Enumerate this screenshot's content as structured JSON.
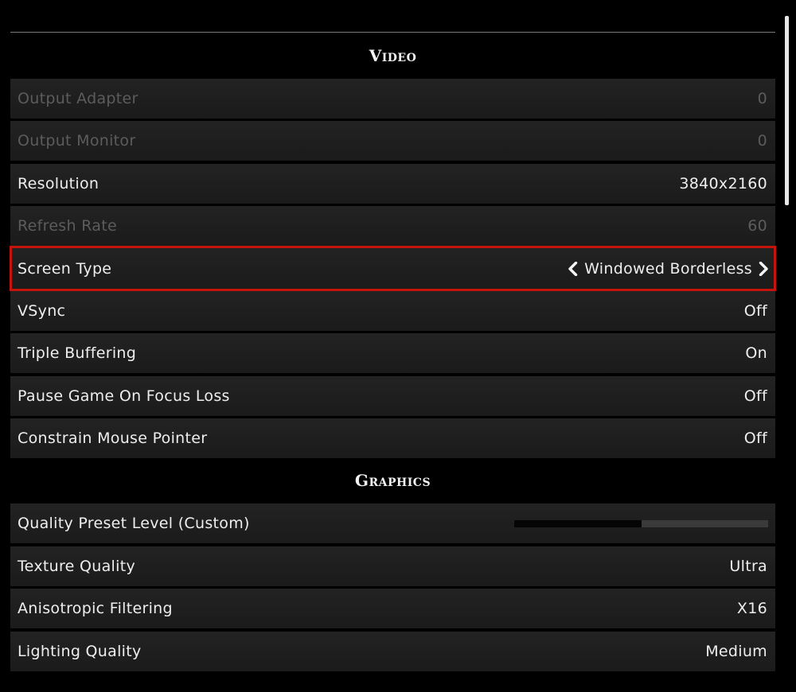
{
  "sections": {
    "video": {
      "title": "Video"
    },
    "graphics": {
      "title": "Graphics"
    }
  },
  "video_rows": [
    {
      "label": "Output Adapter",
      "value": "0",
      "enabled": false
    },
    {
      "label": "Output Monitor",
      "value": "0",
      "enabled": false
    },
    {
      "label": "Resolution",
      "value": "3840x2160",
      "enabled": true
    },
    {
      "label": "Refresh Rate",
      "value": "60",
      "enabled": false
    },
    {
      "label": "Screen Type",
      "value": "Windowed Borderless",
      "enabled": true,
      "selected": true
    },
    {
      "label": "VSync",
      "value": "Off",
      "enabled": true
    },
    {
      "label": "Triple Buffering",
      "value": "On",
      "enabled": true
    },
    {
      "label": "Pause Game On Focus Loss",
      "value": "Off",
      "enabled": true
    },
    {
      "label": "Constrain Mouse Pointer",
      "value": "Off",
      "enabled": true
    }
  ],
  "graphics_rows": [
    {
      "label": "Quality Preset Level (Custom)",
      "slider_fraction": 0.5
    },
    {
      "label": "Texture Quality",
      "value": "Ultra"
    },
    {
      "label": "Anisotropic Filtering",
      "value": "X16"
    },
    {
      "label": "Lighting Quality",
      "value": "Medium"
    }
  ],
  "icons": {
    "left": "chevron-left-icon",
    "right": "chevron-right-icon"
  },
  "colors": {
    "highlight_border": "#c4140c",
    "row_background": "#1f1f1f",
    "disabled_text": "#5c5c5c",
    "slider_track": "#3a3a3a",
    "slider_fill": "#050505"
  }
}
